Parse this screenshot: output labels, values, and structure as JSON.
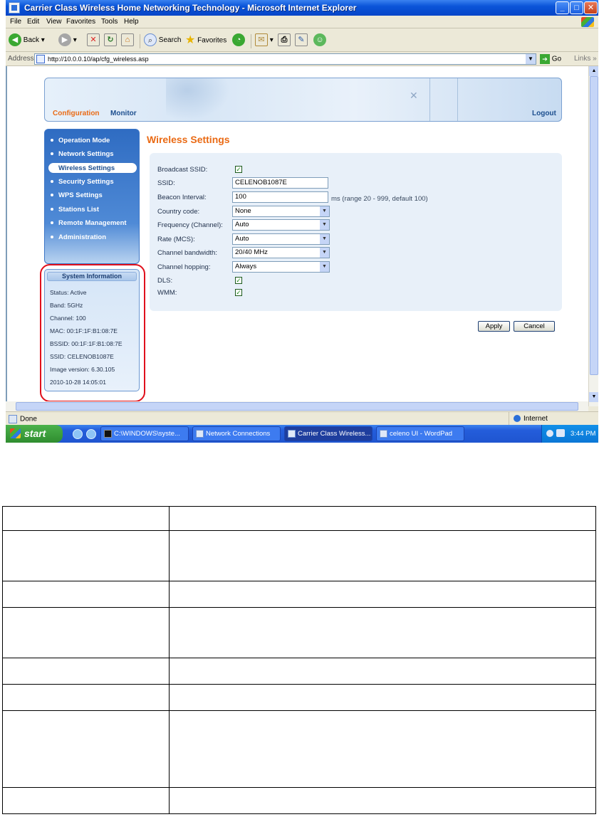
{
  "window": {
    "title": "Carrier Class Wireless Home Networking Technology - Microsoft Internet Explorer",
    "buttons": {
      "minimize": "_",
      "maximize": "□",
      "close": "✕"
    }
  },
  "menubar": [
    "File",
    "Edit",
    "View",
    "Favorites",
    "Tools",
    "Help"
  ],
  "toolbar": {
    "back": "Back",
    "search": "Search",
    "favorites": "Favorites"
  },
  "address": {
    "label": "Address",
    "url": "http://10.0.0.10/ap/cfg_wireless.asp",
    "go": "Go",
    "links": "Links"
  },
  "header": {
    "configuration": "Configuration",
    "monitor": "Monitor",
    "logout": "Logout"
  },
  "sidebar": {
    "items": [
      {
        "label": "Operation Mode",
        "active": false
      },
      {
        "label": "Network Settings",
        "active": false
      },
      {
        "label": "Wireless Settings",
        "active": true
      },
      {
        "label": "Security Settings",
        "active": false
      },
      {
        "label": "WPS Settings",
        "active": false
      },
      {
        "label": "Stations List",
        "active": false
      },
      {
        "label": "Remote Management",
        "active": false
      },
      {
        "label": "Administration",
        "active": false
      }
    ]
  },
  "system_info": {
    "title": "System Information",
    "rows": [
      "Status: Active",
      "Band: 5GHz",
      "Channel: 100",
      "MAC: 00:1F:1F:B1:08:7E",
      "BSSID: 00:1F:1F:B1:08:7E",
      "SSID: CELENOB1087E",
      "Image version: 6.30.105",
      "2010-10-28 14:05:01"
    ]
  },
  "page": {
    "title": "Wireless Settings"
  },
  "form": {
    "broadcast_ssid": {
      "label": "Broadcast SSID:",
      "checked": true
    },
    "ssid": {
      "label": "SSID:",
      "value": "CELENOB1087E"
    },
    "beacon_interval": {
      "label": "Beacon Interval:",
      "value": "100",
      "hint": "ms (range 20 - 999, default 100)"
    },
    "country_code": {
      "label": "Country code:",
      "value": "None"
    },
    "frequency": {
      "label": "Frequency (Channel):",
      "value": "Auto"
    },
    "rate": {
      "label": "Rate (MCS):",
      "value": "Auto"
    },
    "channel_bandwidth": {
      "label": "Channel bandwidth:",
      "value": "20/40 MHz"
    },
    "channel_hopping": {
      "label": "Channel hopping:",
      "value": "Always"
    },
    "dls": {
      "label": "DLS:",
      "checked": true
    },
    "wmm": {
      "label": "WMM:",
      "checked": true
    },
    "check_mark": "✓",
    "apply": "Apply",
    "cancel": "Cancel"
  },
  "statusbar": {
    "status": "Done",
    "zone": "Internet"
  },
  "taskbar": {
    "start": "start",
    "tasks": [
      {
        "label": "C:\\WINDOWS\\syste...",
        "active": false
      },
      {
        "label": "Network Connections",
        "active": false
      },
      {
        "label": "Carrier Class Wireless...",
        "active": true
      },
      {
        "label": "celeno UI - WordPad",
        "active": false
      }
    ],
    "clock": "3:44 PM"
  }
}
